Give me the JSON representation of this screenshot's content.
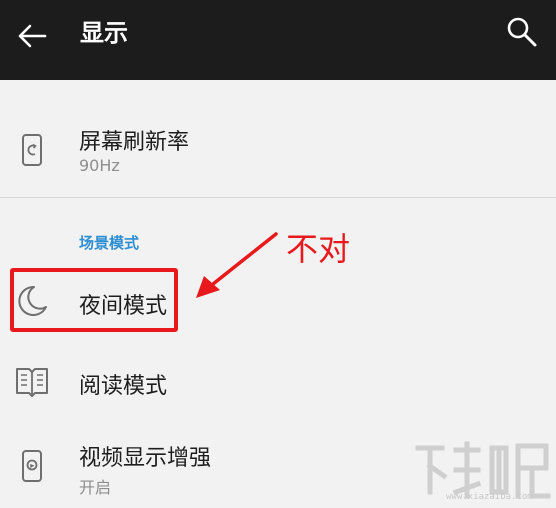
{
  "app_bar": {
    "title": "显示",
    "back_icon": "arrow-left-icon",
    "search_icon": "search-icon"
  },
  "refresh_rate": {
    "title": "屏幕刷新率",
    "value": "90Hz",
    "icon": "phone-refresh-icon"
  },
  "scene_section": {
    "header": "场景模式",
    "items": [
      {
        "title": "夜间模式",
        "icon": "moon-icon"
      },
      {
        "title": "阅读模式",
        "icon": "book-icon"
      },
      {
        "title": "视频显示增强",
        "subtitle": "开启",
        "icon": "phone-video-icon"
      }
    ]
  },
  "annotation": {
    "text": "不对",
    "color": "#e8191c"
  },
  "watermark": {
    "url": "www.xiazaiba.com"
  },
  "colors": {
    "app_bar_bg": "#1c1c1c",
    "background": "#f2f2f2",
    "accent": "#2e8fd3",
    "annotation": "#e8191c"
  }
}
